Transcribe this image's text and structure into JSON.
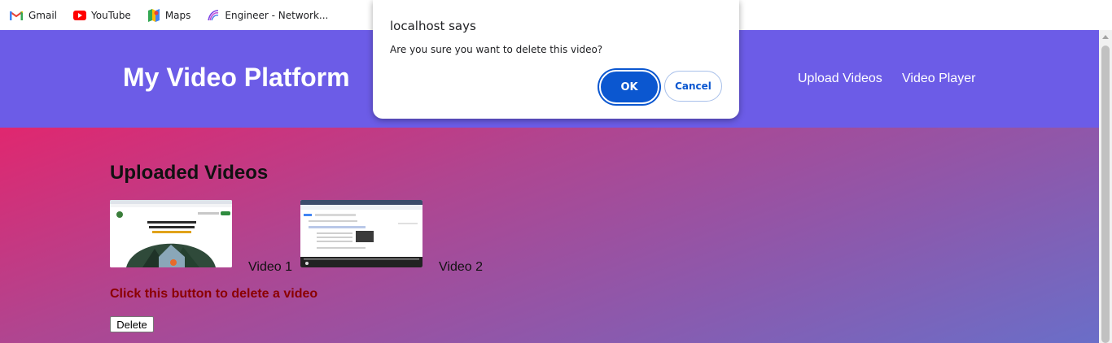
{
  "bookmarks": [
    {
      "label": "Gmail",
      "icon": "gmail-icon"
    },
    {
      "label": "YouTube",
      "icon": "youtube-icon"
    },
    {
      "label": "Maps",
      "icon": "maps-icon"
    },
    {
      "label": "Engineer - Network...",
      "icon": "engineer-icon"
    }
  ],
  "header": {
    "title": "My Video Platform",
    "nav": [
      "Upload Videos",
      "Video Player"
    ]
  },
  "main": {
    "section_title": "Uploaded Videos",
    "videos": [
      {
        "label": "Video 1",
        "thumb_caption": "Committed to building a healthier, more sustainable",
        "thumb_highlight": "future by reducing food waste"
      },
      {
        "label": "Video 2"
      }
    ],
    "delete_hint": "Click this button to delete a video",
    "delete_button": "Delete"
  },
  "dialog": {
    "title": "localhost says",
    "message": "Are you sure you want to delete this video?",
    "ok": "OK",
    "cancel": "Cancel"
  },
  "colors": {
    "header_bg": "#6c5ce7",
    "dialog_accent": "#0b57d0",
    "delete_hint": "#8b0000"
  }
}
